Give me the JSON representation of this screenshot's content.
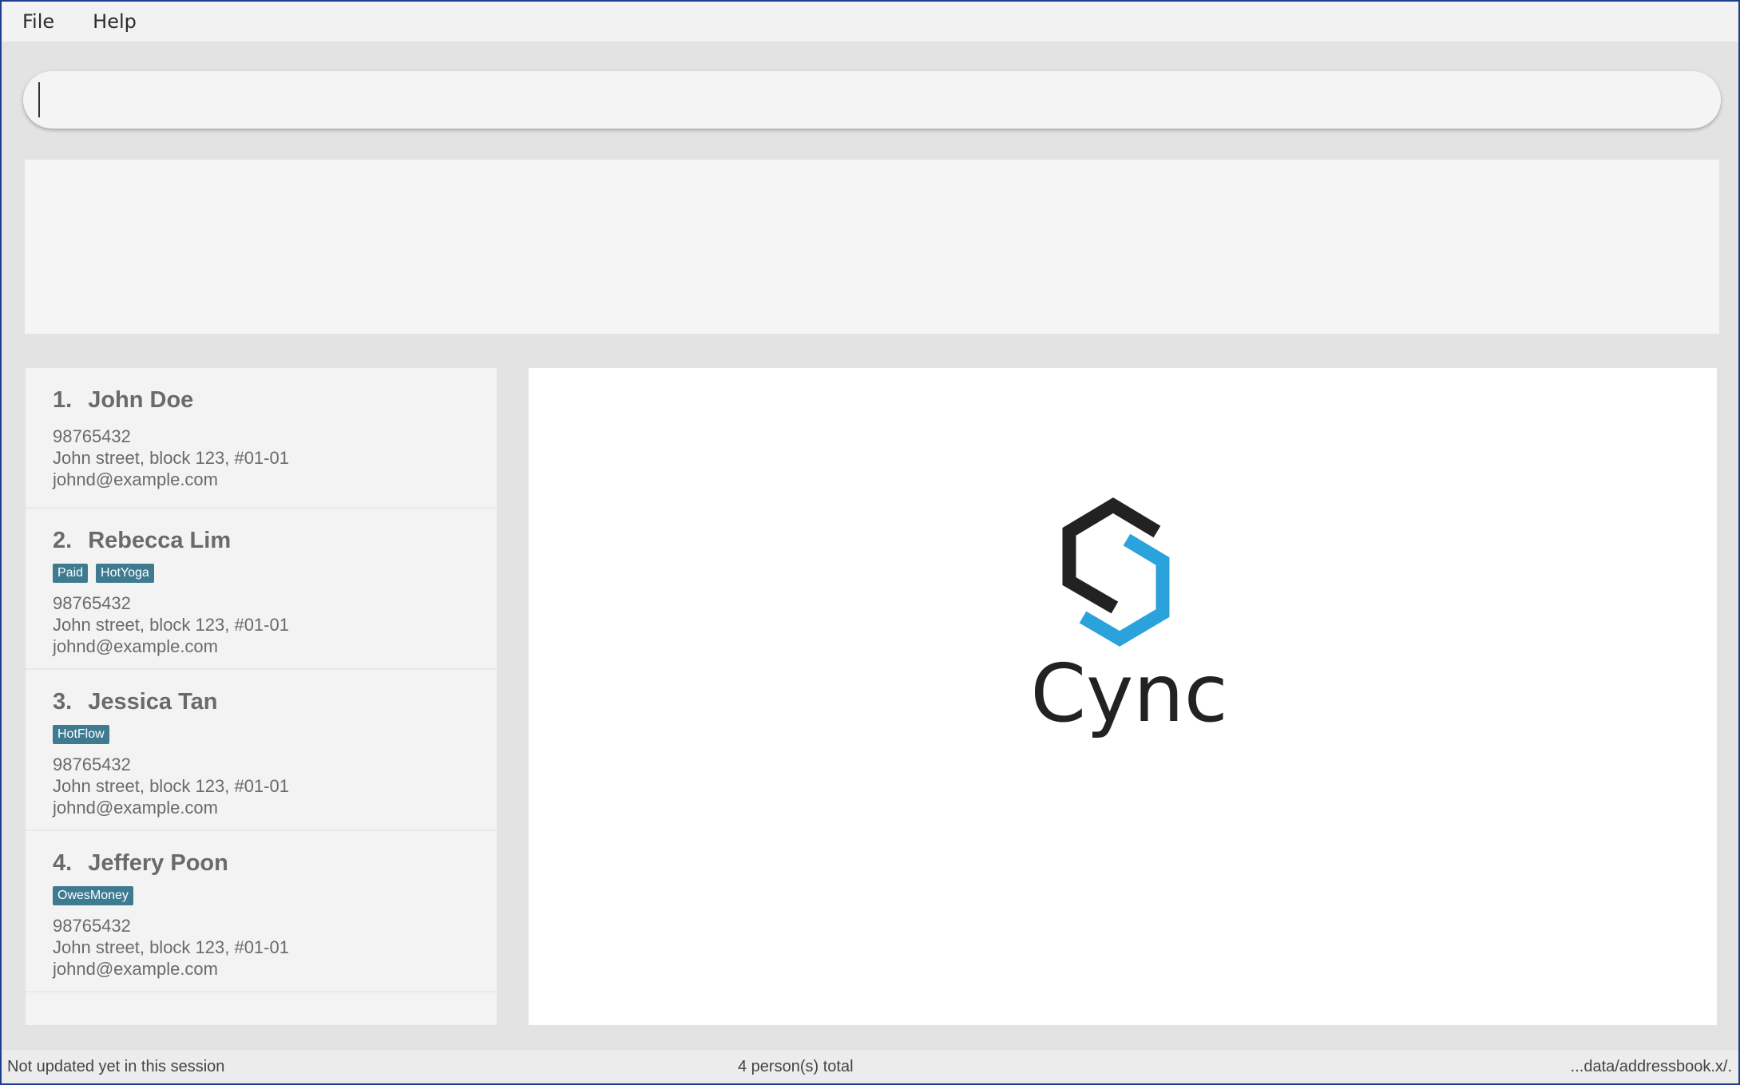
{
  "menu": {
    "file": "File",
    "help": "Help"
  },
  "command_box": {
    "value": "",
    "placeholder": ""
  },
  "persons": [
    {
      "index": "1.",
      "name": "John Doe",
      "tags": [],
      "phone": "98765432",
      "address": "John street, block 123, #01-01",
      "email": "johnd@example.com"
    },
    {
      "index": "2.",
      "name": "Rebecca Lim",
      "tags": [
        "Paid",
        "HotYoga"
      ],
      "phone": "98765432",
      "address": "John street, block 123, #01-01",
      "email": "johnd@example.com"
    },
    {
      "index": "3.",
      "name": "Jessica Tan",
      "tags": [
        "HotFlow"
      ],
      "phone": "98765432",
      "address": "John street, block 123, #01-01",
      "email": "johnd@example.com"
    },
    {
      "index": "4.",
      "name": "Jeffery Poon",
      "tags": [
        "OwesMoney"
      ],
      "phone": "98765432",
      "address": "John street, block 123, #01-01",
      "email": "johnd@example.com"
    }
  ],
  "preview": {
    "logo_text": "Cync",
    "logo_colors": {
      "dark": "#222222",
      "accent": "#2aa3dc"
    }
  },
  "status_bar": {
    "left": "Not updated yet in this session",
    "center": "4 person(s) total",
    "right": "...data/addressbook.x/."
  }
}
